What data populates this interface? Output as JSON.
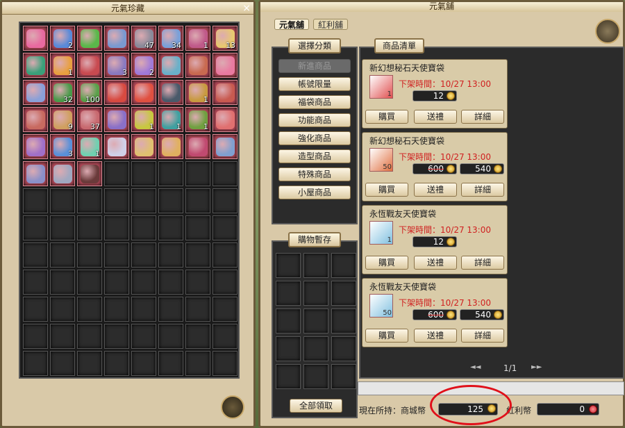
{
  "left_panel": {
    "title": "元氣珍藏",
    "close_label": "×",
    "items": [
      {
        "color": "#e86aa0",
        "count": ""
      },
      {
        "color": "#5a8ad8",
        "count": "2"
      },
      {
        "color": "#5ab84a",
        "count": ""
      },
      {
        "color": "#7a9ad0",
        "count": ""
      },
      {
        "color": "#8a8a9a",
        "count": "47"
      },
      {
        "color": "#7aa0d8",
        "count": "34"
      },
      {
        "color": "#c05a8a",
        "count": "1"
      },
      {
        "color": "#e8c870",
        "count": "13"
      },
      {
        "color": "#3aa07a",
        "count": ""
      },
      {
        "color": "#e8a040",
        "count": "1"
      },
      {
        "color": "#c84a50",
        "count": ""
      },
      {
        "color": "#8a7ac0",
        "count": "3"
      },
      {
        "color": "#a07ad8",
        "count": "2"
      },
      {
        "color": "#6ab0c8",
        "count": ""
      },
      {
        "color": "#c86a50",
        "count": ""
      },
      {
        "color": "#e87aa0",
        "count": ""
      },
      {
        "color": "#8aa0d8",
        "count": ""
      },
      {
        "color": "#4a9a4a",
        "count": "32"
      },
      {
        "color": "#5aa04a",
        "count": "100"
      },
      {
        "color": "#d84a40",
        "count": ""
      },
      {
        "color": "#e05040",
        "count": ""
      },
      {
        "color": "#4a5a6a",
        "count": ""
      },
      {
        "color": "#c89a40",
        "count": "1"
      },
      {
        "color": "#c85a50",
        "count": ""
      },
      {
        "color": "#c86a60",
        "count": ""
      },
      {
        "color": "#d0a060",
        "count": "9"
      },
      {
        "color": "#c86a70",
        "count": "37"
      },
      {
        "color": "#8a70c8",
        "count": ""
      },
      {
        "color": "#c8c840",
        "count": "1"
      },
      {
        "color": "#40a0a0",
        "count": "1"
      },
      {
        "color": "#70a040",
        "count": "1"
      },
      {
        "color": "#e07070",
        "count": ""
      },
      {
        "color": "#a070c8",
        "count": ""
      },
      {
        "color": "#5a90d8",
        "count": "3"
      },
      {
        "color": "#70d0b0",
        "count": "1"
      },
      {
        "color": "#d0d0e8",
        "count": ""
      },
      {
        "color": "#e0c070",
        "count": ""
      },
      {
        "color": "#e0b060",
        "count": ""
      },
      {
        "color": "#c04a70",
        "count": ""
      },
      {
        "color": "#80a0d0",
        "count": ""
      },
      {
        "color": "#8a90c8",
        "count": ""
      },
      {
        "color": "#a0a8c0",
        "count": ""
      },
      {
        "color": "#6a3a3a",
        "count": ""
      }
    ]
  },
  "right_panel": {
    "title": "元氣舖",
    "tabs": [
      {
        "label": "元氣舖"
      },
      {
        "label": "紅利舖"
      }
    ],
    "category_header": "選擇分類",
    "categories": [
      {
        "label": "新進商品",
        "disabled": true
      },
      {
        "label": "帳號限量",
        "disabled": false
      },
      {
        "label": "福袋商品",
        "disabled": false
      },
      {
        "label": "功能商品",
        "disabled": false
      },
      {
        "label": "強化商品",
        "disabled": false
      },
      {
        "label": "造型商品",
        "disabled": false
      },
      {
        "label": "特殊商品",
        "disabled": false
      },
      {
        "label": "小屋商品",
        "disabled": false
      }
    ],
    "cart_header": "購物暫存",
    "claim_all": "全部領取",
    "product_header": "商品清單",
    "products": [
      {
        "name": "新幻想秘石天使寶袋",
        "date": "下架時間：10/27 13:00",
        "count": "1",
        "old_price": "",
        "price": "12",
        "buy": "購買",
        "gift": "送禮",
        "detail": "詳細",
        "color": "#e05050"
      },
      {
        "name": "新幻想秘石天使寶袋",
        "date": "下架時間：10/27 13:00",
        "count": "50",
        "old_price": "600",
        "price": "540",
        "buy": "購買",
        "gift": "送禮",
        "detail": "詳細",
        "color": "#e07040"
      },
      {
        "name": "永恆戰友天使寶袋",
        "date": "下架時間：10/27 13:00",
        "count": "1",
        "old_price": "",
        "price": "12",
        "buy": "購買",
        "gift": "送禮",
        "detail": "詳細",
        "color": "#80c0e0"
      },
      {
        "name": "永恆戰友天使寶袋",
        "date": "下架時間：10/27 13:00",
        "count": "50",
        "old_price": "600",
        "price": "540",
        "buy": "購買",
        "gift": "送禮",
        "detail": "詳細",
        "color": "#80c0e0"
      }
    ],
    "pager": {
      "text": "1/1",
      "prev": "◄◄",
      "next": "►►"
    },
    "holdings_label": "現在所持：商城幣",
    "mall_coins": "125",
    "bonus_label": "紅利幣",
    "bonus_coins": "0"
  }
}
